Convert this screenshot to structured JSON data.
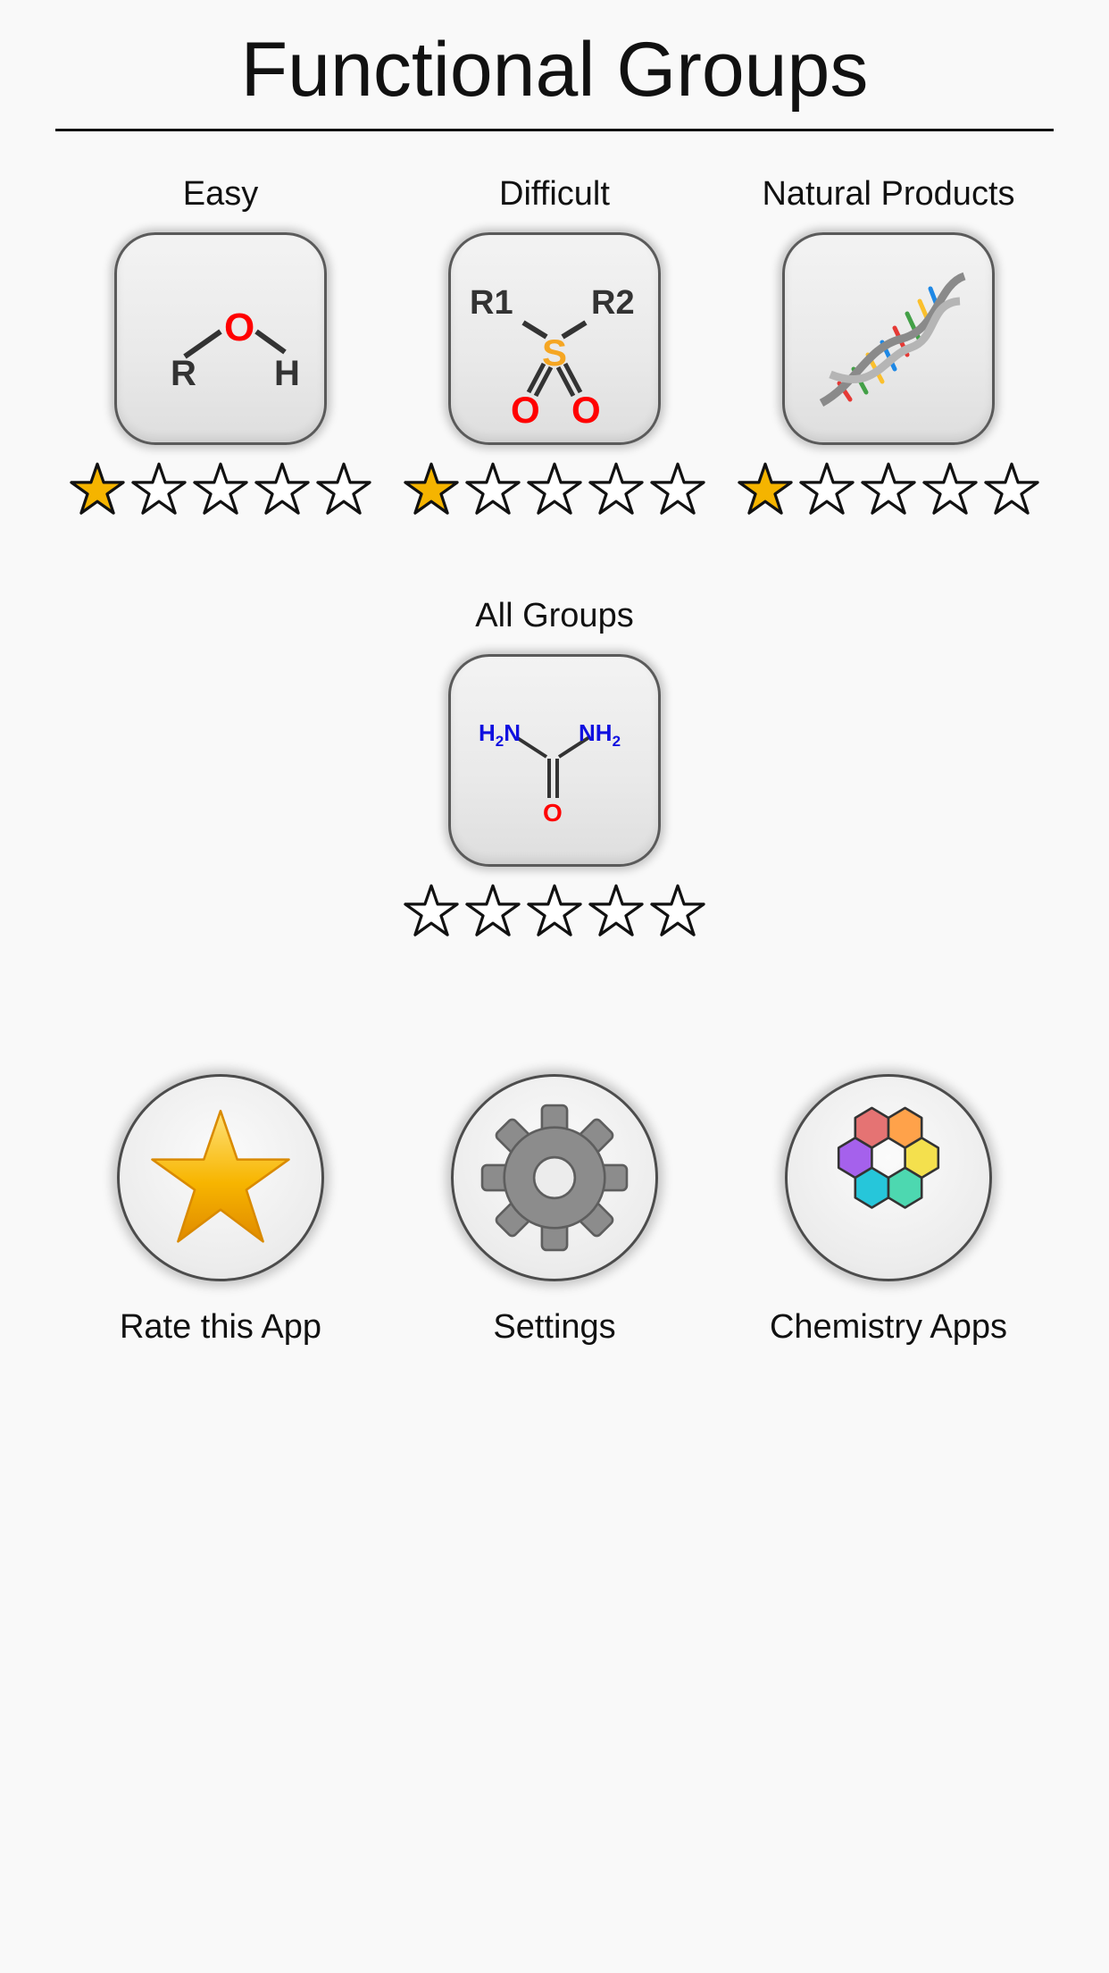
{
  "header": {
    "title": "Functional Groups"
  },
  "levels": [
    {
      "label": "Easy",
      "icon": "hydroxyl-structure-icon",
      "icon_text": {
        "r": "R",
        "o": "O",
        "h": "H"
      },
      "rating": 1,
      "max_rating": 5
    },
    {
      "label": "Difficult",
      "icon": "sulfonyl-structure-icon",
      "icon_text": {
        "r1": "R1",
        "r2": "R2",
        "s": "S",
        "o": "O"
      },
      "rating": 1,
      "max_rating": 5
    },
    {
      "label": "Natural Products",
      "icon": "dna-helix-icon",
      "rating": 1,
      "max_rating": 5
    },
    {
      "label": "All Groups",
      "icon": "urea-structure-icon",
      "icon_text": {
        "h2n": "H",
        "sub2": "2",
        "n": "N",
        "nh": "NH",
        "o": "O"
      },
      "rating": 0,
      "max_rating": 5
    }
  ],
  "actions": {
    "rate": {
      "label": "Rate this App",
      "icon": "star-icon"
    },
    "settings": {
      "label": "Settings",
      "icon": "gear-icon"
    },
    "chemistry": {
      "label": "Chemistry Apps",
      "icon": "hexagon-rings-icon"
    }
  },
  "colors": {
    "background": "#f9f9f9",
    "star_filled": "#f5b400",
    "oxygen": "#ff0000",
    "sulfur": "#f5a623",
    "nitrogen": "#1010e0",
    "carbon": "#333333"
  }
}
